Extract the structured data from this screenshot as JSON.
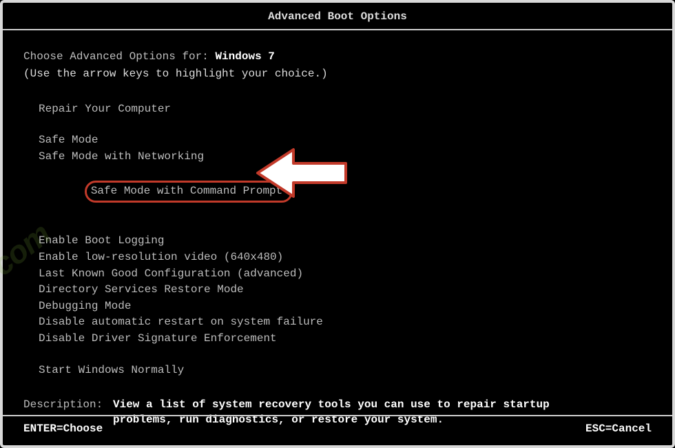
{
  "header": {
    "title": "Advanced Boot Options"
  },
  "prompt": {
    "prefix": "Choose Advanced Options for: ",
    "os": "Windows 7",
    "hint": "(Use the arrow keys to highlight your choice.)"
  },
  "menu": {
    "group1": {
      "repair": "Repair Your Computer"
    },
    "group2": {
      "safe_mode": "Safe Mode",
      "safe_mode_net": "Safe Mode with Networking",
      "safe_mode_cmd": "Safe Mode with Command Prompt"
    },
    "group3": {
      "boot_logging": "Enable Boot Logging",
      "low_res": "Enable low-resolution video (640x480)",
      "lkg": "Last Known Good Configuration (advanced)",
      "ds_restore": "Directory Services Restore Mode",
      "debug": "Debugging Mode",
      "no_auto_restart": "Disable automatic restart on system failure",
      "no_driver_sig": "Disable Driver Signature Enforcement"
    },
    "group4": {
      "start_normal": "Start Windows Normally"
    }
  },
  "description": {
    "label": "Description:",
    "text": "View a list of system recovery tools you can use to repair startup problems, run diagnostics, or restore your system."
  },
  "footer": {
    "enter": "ENTER=Choose",
    "esc": "ESC=Cancel"
  },
  "watermark": ".com"
}
